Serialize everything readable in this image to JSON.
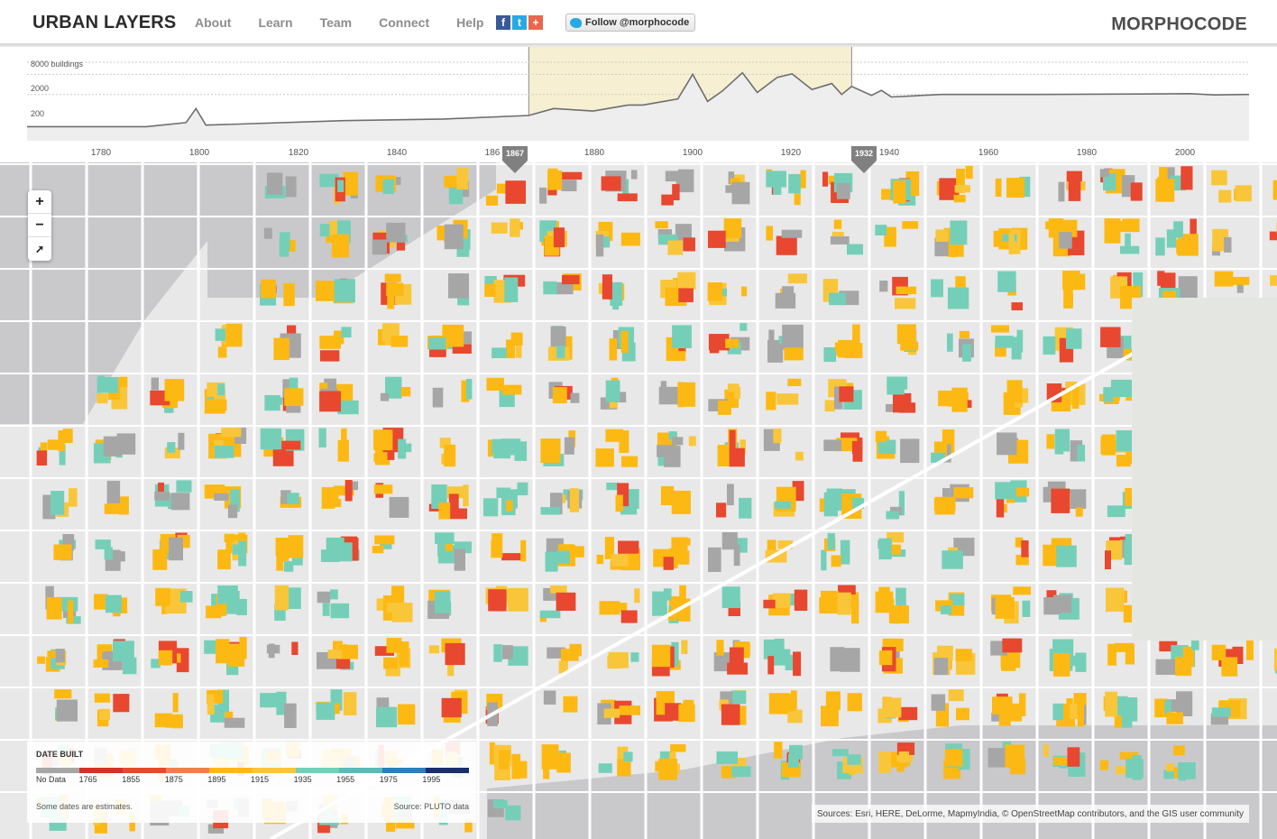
{
  "header": {
    "logo": "URBAN LAYERS",
    "nav": [
      "About",
      "Learn",
      "Team",
      "Connect",
      "Help"
    ],
    "social": {
      "facebook": "f",
      "twitter": "t",
      "googleplus": "+"
    },
    "follow_label": "Follow @morphocode",
    "brand": "MORPHOCODE"
  },
  "timeline": {
    "y_labels": [
      "8000 buildings",
      "2000",
      "200"
    ],
    "x_ticks": [
      "1780",
      "1800",
      "1820",
      "1840",
      "186",
      "1880",
      "1900",
      "1920",
      "1940",
      "1960",
      "1980",
      "2000"
    ],
    "range_start": "1867",
    "range_end": "1932"
  },
  "chart_data": {
    "type": "area",
    "title": "",
    "xlabel": "",
    "ylabel": "8000 buildings",
    "xlim": [
      1766,
      2012
    ],
    "x": [
      1766,
      1790,
      1798,
      1800,
      1802,
      1830,
      1850,
      1867,
      1872,
      1880,
      1887,
      1890,
      1897,
      1900,
      1903,
      1906,
      1910,
      1913,
      1917,
      1920,
      1924,
      1928,
      1930,
      1932,
      1936,
      1938,
      1940,
      1950,
      1970,
      1990,
      2000,
      2005,
      2012
    ],
    "y": [
      5,
      5,
      8,
      40,
      6,
      10,
      12,
      18,
      40,
      30,
      60,
      60,
      120,
      2000,
      90,
      300,
      2400,
      250,
      1400,
      2100,
      350,
      700,
      200,
      500,
      180,
      320,
      150,
      200,
      200,
      210,
      220,
      190,
      200
    ]
  },
  "map": {
    "zoom_in": "+",
    "zoom_out": "−",
    "compass": "➚"
  },
  "legend": {
    "title": "DATE BUILT",
    "labels": [
      "No Data",
      "1765",
      "1855",
      "1875",
      "1895",
      "1915",
      "1935",
      "1955",
      "1975",
      "1995"
    ],
    "colors": [
      "#a6a6a6",
      "#d73027",
      "#e8482f",
      "#f27c52",
      "#fdb913",
      "#f9c63a",
      "#75cfb8",
      "#5fb8b6",
      "#2c7fb8",
      "#1a2f6b"
    ],
    "note": "Some dates are estimates.",
    "source": "Source: PLUTO data"
  },
  "attribution": "Sources: Esri, HERE, DeLorme, MapmyIndia, © OpenStreetMap contributors, and the GIS user community"
}
